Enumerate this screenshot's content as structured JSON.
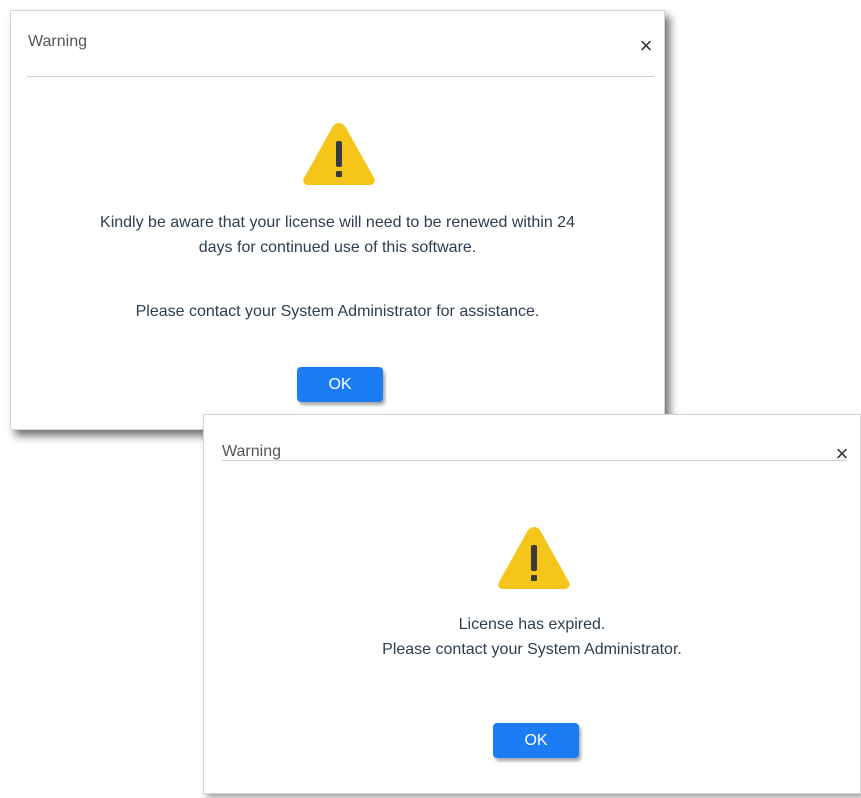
{
  "dialogs": [
    {
      "title": "Warning",
      "close_glyph": "×",
      "icon": "warning-triangle-icon",
      "message_lines": [
        "Kindly be aware that your license will need to be renewed within 24",
        "days for continued use of this software."
      ],
      "secondary_message": "Please contact your System Administrator for assistance.",
      "ok_label": "OK"
    },
    {
      "title": "Warning",
      "close_glyph": "×",
      "icon": "warning-triangle-icon",
      "message_lines": [
        "License has expired.",
        "Please contact your System Administrator."
      ],
      "ok_label": "OK"
    }
  ],
  "colors": {
    "ok_button": "#1b7cf3",
    "warning_icon": "#f5c51a",
    "message_text": "#2c3e50",
    "divider": "#cfcfcf"
  }
}
